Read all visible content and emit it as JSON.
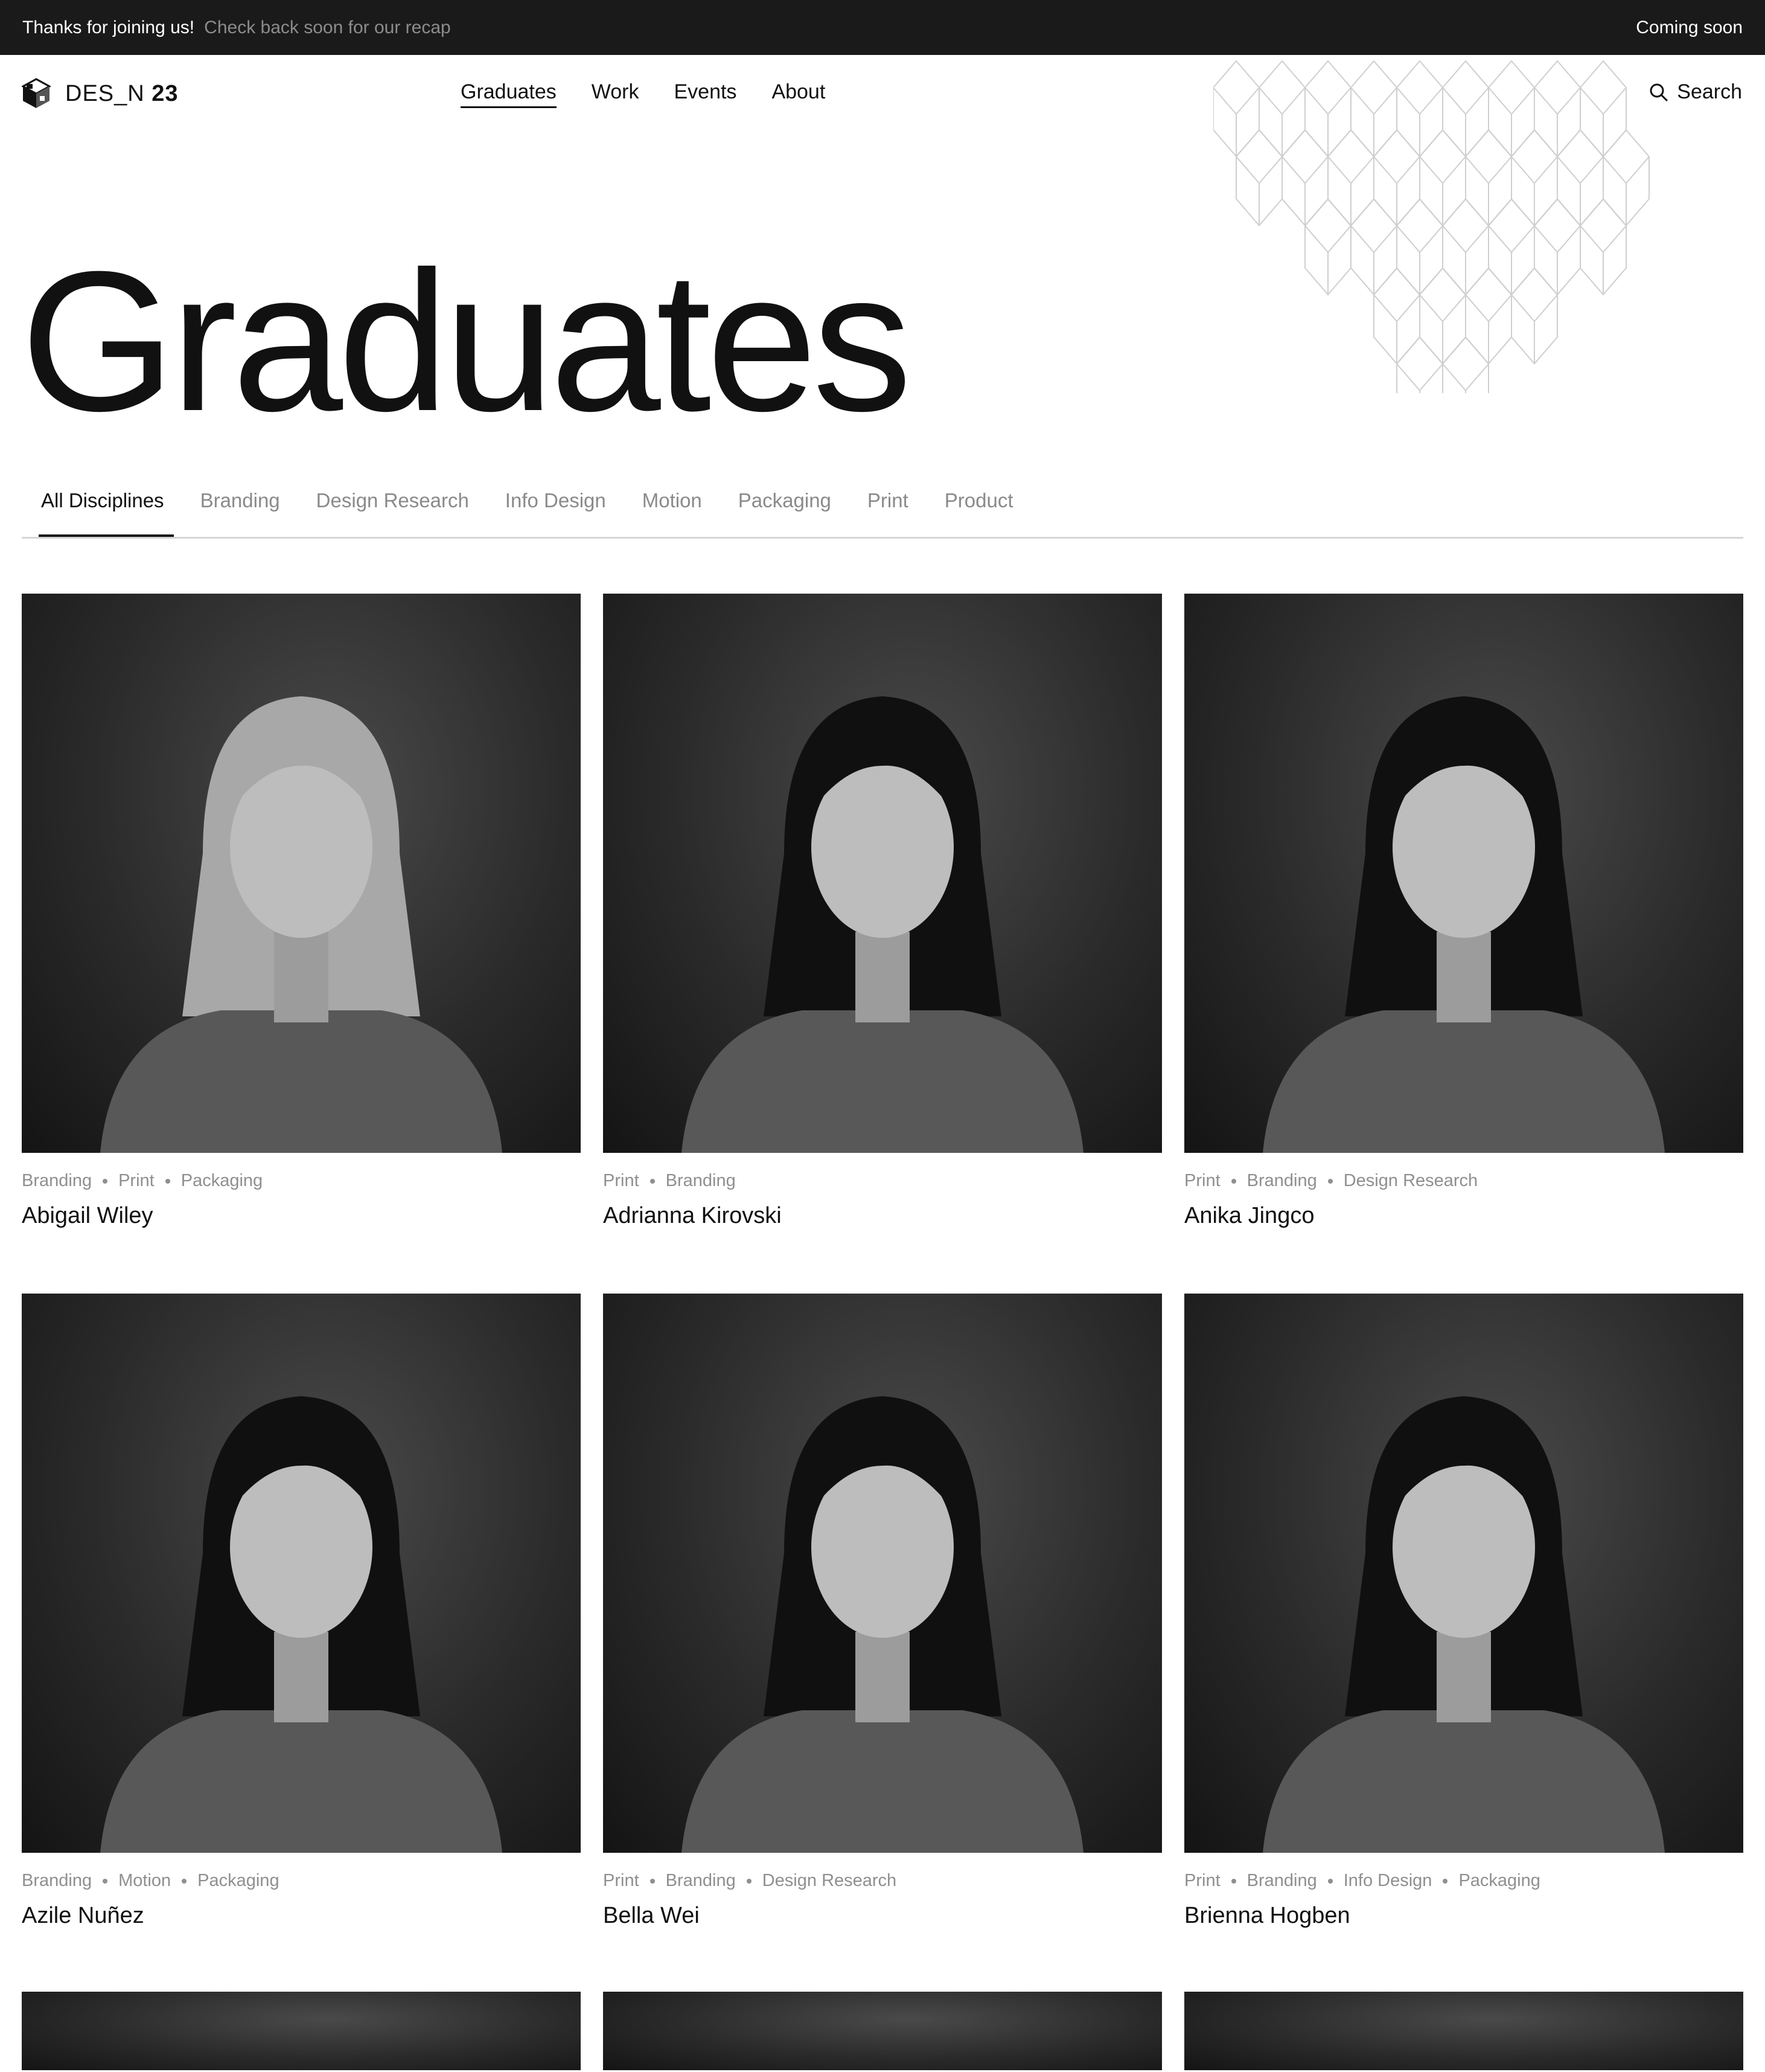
{
  "announcement": {
    "message": "Thanks for joining us!",
    "sub": "Check back soon for our recap",
    "right": "Coming soon"
  },
  "header": {
    "logo_text_a": "DES_N",
    "logo_text_b": "23",
    "nav": [
      "Graduates",
      "Work",
      "Events",
      "About"
    ],
    "search_label": "Search"
  },
  "page": {
    "title": "Graduates"
  },
  "filters": [
    "All Disciplines",
    "Branding",
    "Design Research",
    "Info Design",
    "Motion",
    "Packaging",
    "Print",
    "Product"
  ],
  "graduates": [
    {
      "name": "Abigail Wiley",
      "tags": [
        "Branding",
        "Print",
        "Packaging"
      ],
      "hair": "light"
    },
    {
      "name": "Adrianna Kirovski",
      "tags": [
        "Print",
        "Branding"
      ],
      "hair": "dark"
    },
    {
      "name": "Anika Jingco",
      "tags": [
        "Print",
        "Branding",
        "Design Research"
      ],
      "hair": "dark"
    },
    {
      "name": "Azile Nuñez",
      "tags": [
        "Branding",
        "Motion",
        "Packaging"
      ],
      "hair": "dark"
    },
    {
      "name": "Bella Wei",
      "tags": [
        "Print",
        "Branding",
        "Design Research"
      ],
      "hair": "dark"
    },
    {
      "name": "Brienna Hogben",
      "tags": [
        "Print",
        "Branding",
        "Info Design",
        "Packaging"
      ],
      "hair": "dark"
    }
  ]
}
